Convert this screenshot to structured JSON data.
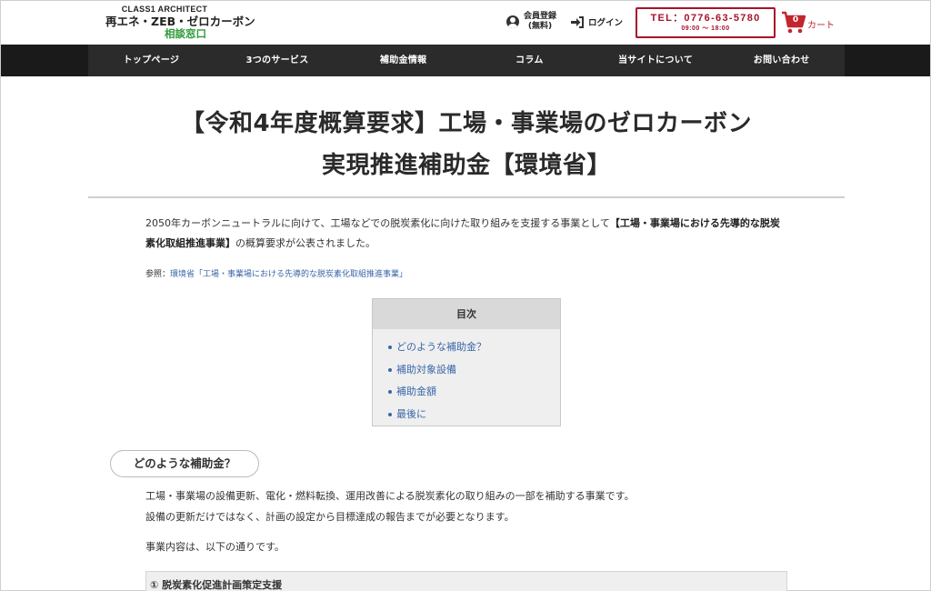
{
  "header": {
    "logo_top": "CLASS1 ARCHITECT",
    "logo_main": "再エネ・ZEB・ゼロカーボン",
    "logo_sub": "相談窓口",
    "member_line1": "会員登録",
    "member_line2": "(無料)",
    "login": "ログイン",
    "tel": "TEL：0776-63-5780",
    "tel_hours": "09:00 〜 18:00",
    "cart_count": "0",
    "cart_label": "カート",
    "colors": {
      "accent": "#a7122a",
      "cart": "#c1272d",
      "logo_sub": "#2e9b3a"
    }
  },
  "nav": [
    {
      "label": "トップページ"
    },
    {
      "label": "3つのサービス"
    },
    {
      "label": "補助金情報"
    },
    {
      "label": "コラム"
    },
    {
      "label": "当サイトについて"
    },
    {
      "label": "お問い合わせ"
    }
  ],
  "article": {
    "title": "【令和4年度概算要求】工場・事業場のゼロカーボン実現推進補助金【環境省】",
    "intro_plain": "2050年カーボンニュートラルに向けて、工場などでの脱炭素化に向けた取り組みを支援する事業として",
    "intro_bold": "【工場・事業場における先導的な脱炭素化取組推進事業】",
    "intro_tail": "の概算要求が公表されました。",
    "ref_label": "参照：",
    "ref_link": "環境省「工場・事業場における先導的な脱炭素化取組推進事業」"
  },
  "toc": {
    "heading": "目次",
    "items": [
      {
        "label": "どのような補助金？"
      },
      {
        "label": "補助対象設備"
      },
      {
        "label": "補助金額"
      },
      {
        "label": "最後に"
      }
    ]
  },
  "section1": {
    "heading": "どのような補助金？",
    "line1": "工場・事業場の設備更新、電化・燃料転換、運用改善による脱炭素化の取り組みの一部を補助する事業です。",
    "line2": "設備の更新だけではなく、計画の設定から目標達成の報告までが必要となります。",
    "line3": "事業内容は、以下の通りです。",
    "subbox": "① 脱炭素化促進計画策定支援"
  }
}
